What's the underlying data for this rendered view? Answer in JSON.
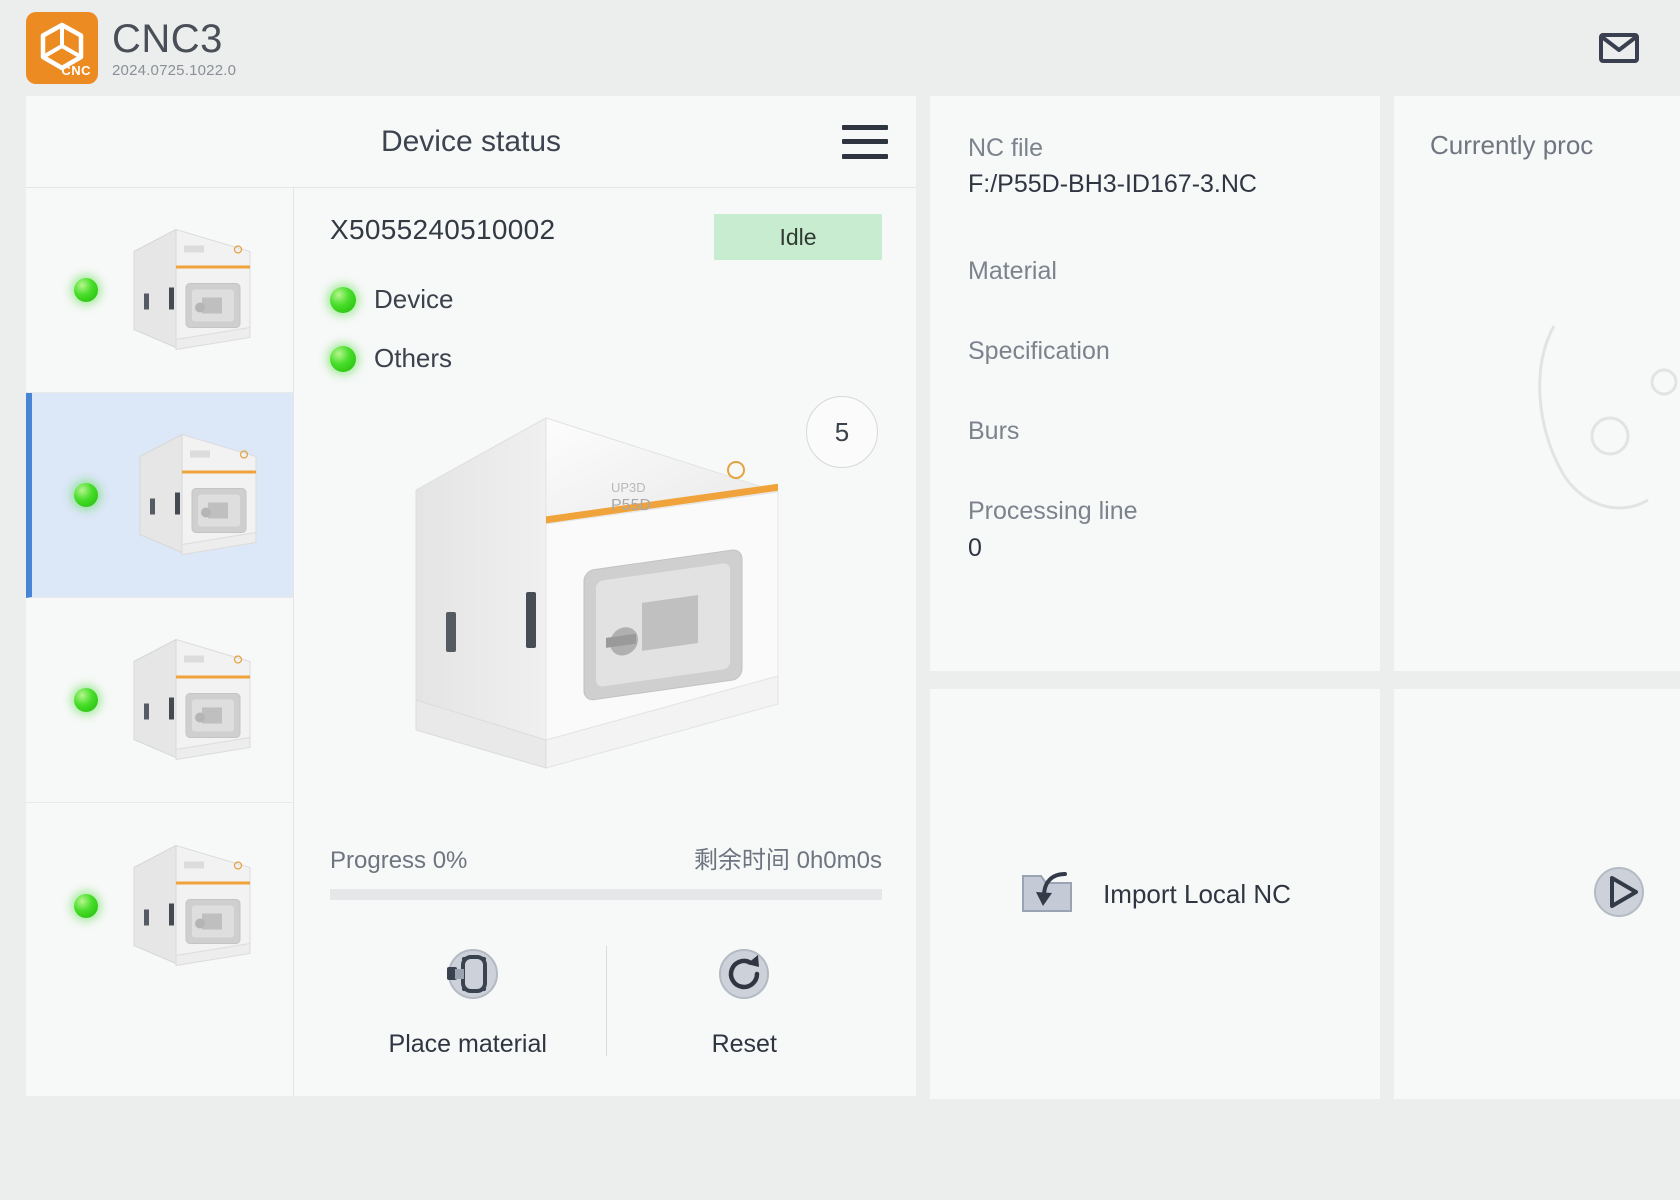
{
  "header": {
    "app_title": "CNC3",
    "version": "2024.0725.1022.0",
    "logo_mark": "CNC",
    "logo_color": "#ed8b23",
    "mail_icon": "envelope-icon"
  },
  "device_panel": {
    "title": "Device status",
    "menu_icon": "hamburger-menu-icon",
    "serial": "X5055240510002",
    "status": "Idle",
    "status_bg": "#c8ecd0",
    "flags": [
      {
        "label": "Device",
        "state": "ok",
        "color": "#3cd41c"
      },
      {
        "label": "Others",
        "state": "ok",
        "color": "#3cd41c"
      }
    ],
    "count_badge": "5",
    "progress_label": "Progress 0%",
    "progress_percent": 0,
    "remaining_label": "剩余时间 0h0m0s",
    "actions": [
      {
        "label": "Place material",
        "icon": "place-material-icon"
      },
      {
        "label": "Reset",
        "icon": "reset-icon"
      }
    ]
  },
  "machine_list": [
    {
      "index": 1,
      "led": "green",
      "selected": false
    },
    {
      "index": 2,
      "led": "green",
      "selected": true
    },
    {
      "index": 3,
      "led": "green",
      "selected": false
    },
    {
      "index": 4,
      "led": "green",
      "selected": false
    }
  ],
  "nc_info": {
    "fields": [
      {
        "label": "NC file",
        "value": "F:/P55D-BH3-ID167-3.NC"
      },
      {
        "label": "Material",
        "value": ""
      },
      {
        "label": "Specification",
        "value": ""
      },
      {
        "label": "Burs",
        "value": ""
      },
      {
        "label": "Processing line",
        "value": "0"
      }
    ]
  },
  "import_panel": {
    "label": "Import Local NC",
    "icon": "folder-import-icon"
  },
  "processing_panel": {
    "title": "Currently proc",
    "play_icon": "play-icon"
  },
  "colors": {
    "page_bg": "#eceded",
    "card_bg": "#f7f8f8",
    "accent_blue": "#4784d6",
    "selected_row_bg": "#dce7f8",
    "brand_orange": "#ed8b23"
  }
}
